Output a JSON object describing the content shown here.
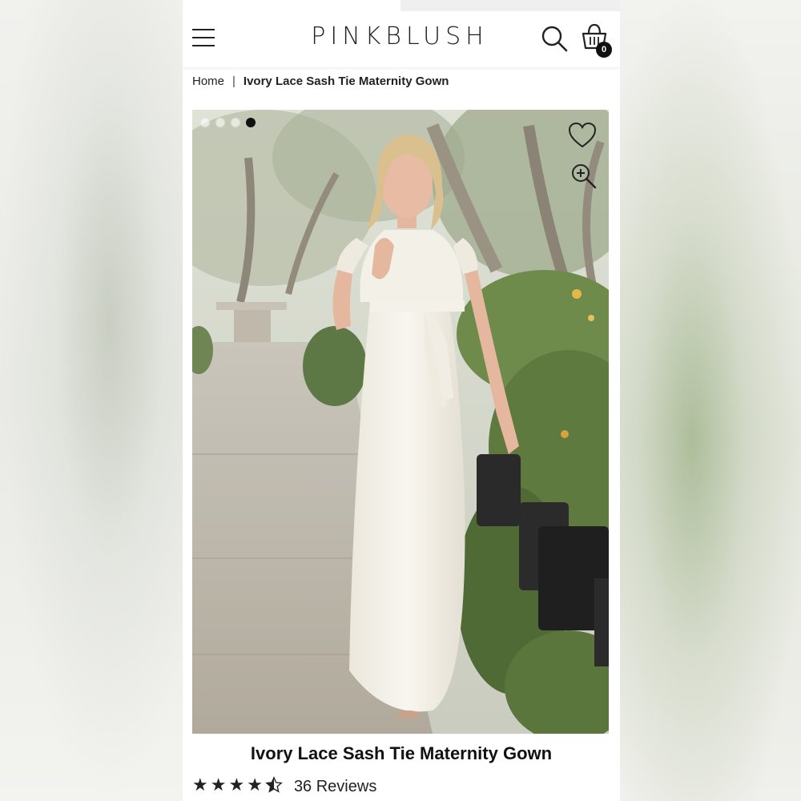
{
  "header": {
    "brand": "PINKBLUSH",
    "cart_count": "0"
  },
  "breadcrumb": {
    "home": "Home",
    "separator": "|",
    "current": "Ivory Lace Sash Tie Maternity Gown"
  },
  "gallery": {
    "image_count": 4,
    "active_index": 3
  },
  "product": {
    "title": "Ivory Lace Sash Tie Maternity Gown",
    "rating": 4.5,
    "reviews_label": "36 Reviews"
  },
  "colors": {
    "text": "#222222",
    "dress": "#f5f2ea",
    "foliage": "#5f7a3e"
  },
  "icons": [
    "menu-icon",
    "search-icon",
    "cart-icon",
    "heart-icon",
    "zoom-in-icon",
    "star-icon"
  ]
}
